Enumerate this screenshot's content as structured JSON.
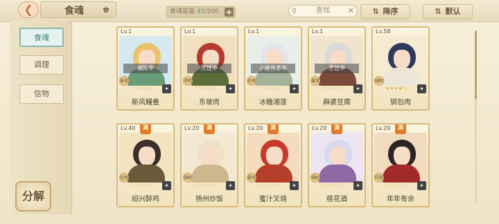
{
  "header": {
    "title": "食魂",
    "capacity_label": "食魂容量",
    "capacity_used": "45",
    "capacity_total": "/200",
    "search_placeholder": "查找",
    "sort_desc_label": "降序",
    "sort_default_label": "默认"
  },
  "sidebar": {
    "tabs": [
      {
        "label": "食魂",
        "active": true
      },
      {
        "label": "调理",
        "active": false
      },
      {
        "label": "信物",
        "active": false
      }
    ],
    "decompose_label": "分解"
  },
  "cards": [
    {
      "level": "Lv.1",
      "name": "新风鳗鲞",
      "status": "编队中",
      "element": "振攻",
      "stars": "☆☆☆☆☆",
      "hair": "#e9c46a",
      "body": "#6a9c7a",
      "bg": "#d7e9f0"
    },
    {
      "level": "Lv.1",
      "name": "东坡肉",
      "status": "烹饪中",
      "element": "冲刺",
      "stars": "☆☆☆☆☆",
      "hair": "#b63b2f",
      "body": "#5c6e3a",
      "bg": "#f0e0c0"
    },
    {
      "level": "Lv.1",
      "name": "冰糖湘莲",
      "status": "小屋休息中",
      "element": "控场",
      "stars": "☆☆☆☆☆",
      "hair": "#e4e4ea",
      "body": "#a3b29a",
      "bg": "#e8efe9"
    },
    {
      "level": "Lv.1",
      "name": "麻婆豆腐",
      "status": "烹饪中",
      "element": "暴攻",
      "stars": "☆☆☆☆☆",
      "hair": "#d9d9d9",
      "body": "#7b4a3a",
      "bg": "#f0e4cc"
    },
    {
      "level": "Lv.58",
      "name": "锅包肉",
      "status": "",
      "element": "辅助",
      "stars": "★★★★☆",
      "hair": "#2c3a5c",
      "body": "#ece6d8",
      "bg": "#f6ead0"
    },
    {
      "level": "Lv.40",
      "name": "绍兴醉鸡",
      "status": "",
      "element": "控场",
      "stars": "☆☆☆☆☆",
      "hair": "#3a2f2a",
      "body": "#6b5a3a",
      "bg": "#f3e3bf"
    },
    {
      "level": "Lv.20",
      "name": "扬州炒饭",
      "status": "",
      "element": "辅助",
      "stars": "☆☆☆☆☆",
      "hair": "#efe1c7",
      "body": "#cbb88f",
      "bg": "#f3e8d2"
    },
    {
      "level": "Lv.20",
      "name": "蜜汁叉烧",
      "status": "",
      "element": "暴攻",
      "stars": "☆☆☆☆☆",
      "hair": "#c73a2e",
      "body": "#b53f2a",
      "bg": "#f4dcbf"
    },
    {
      "level": "Lv.20",
      "name": "桂花酒",
      "status": "",
      "element": "辅助",
      "stars": "☆☆☆☆☆",
      "hair": "#d7d9f0",
      "body": "#8d6aa4",
      "bg": "#ece4f0"
    },
    {
      "level": "Lv.20",
      "name": "年年有余",
      "status": "",
      "element": "防御",
      "stars": "☆☆☆☆☆",
      "hair": "#2c2325",
      "body": "#a32a2a",
      "bg": "#f2dcbf"
    }
  ],
  "ribbons": [
    "满"
  ]
}
